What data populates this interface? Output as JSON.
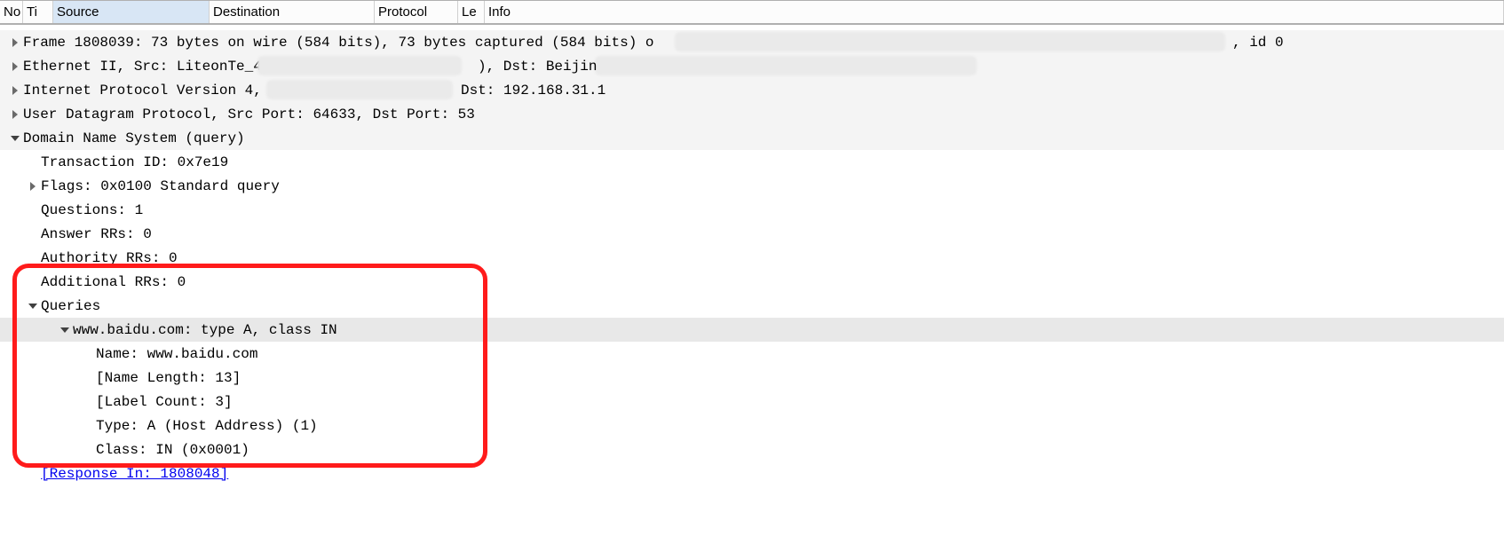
{
  "columns": {
    "no": "No",
    "ti": "Ti",
    "source": "Source",
    "destination": "Destination",
    "protocol": "Protocol",
    "len": "Le",
    "info": "Info"
  },
  "frame": "Frame 1808039: 73 bytes on wire (584 bits), 73 bytes captured (584 bits) o",
  "frame_tail": ", id 0",
  "eth": "Ethernet II, Src: LiteonTe_4",
  "eth_mid": "), Dst: Beijin",
  "ip": "Internet Protocol Version 4,",
  "ip_dst": "Dst: 192.168.31.1",
  "udp": "User Datagram Protocol, Src Port: 64633, Dst Port: 53",
  "dns": "Domain Name System (query)",
  "dns_fields": {
    "txid": "Transaction ID: 0x7e19",
    "flags": "Flags: 0x0100 Standard query",
    "questions": "Questions: 1",
    "answer": "Answer RRs: 0",
    "authority": "Authority RRs: 0",
    "additional": "Additional RRs: 0",
    "queries": "Queries",
    "query_hdr": "www.baidu.com: type A, class IN",
    "q_name": "Name: www.baidu.com",
    "q_namelen": "[Name Length: 13]",
    "q_labcnt": "[Label Count: 3]",
    "q_type": "Type: A (Host Address) (1)",
    "q_class": "Class: IN (0x0001)",
    "response": "[Response In: 1808048]"
  }
}
